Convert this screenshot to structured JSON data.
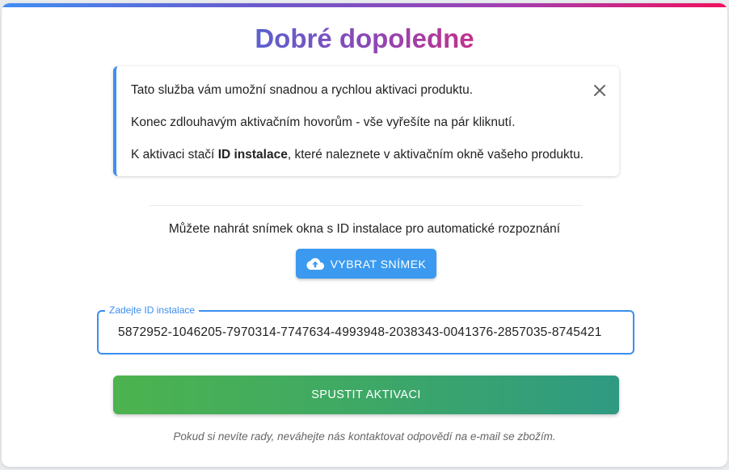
{
  "header": {
    "title": "Dobré dopoledne"
  },
  "info": {
    "line1": "Tato služba vám umožní snadnou a rychlou aktivaci produktu.",
    "line2": "Konec zdlouhavým aktivačním hovorům - vše vyřešíte na pár kliknutí.",
    "line3_before": "K aktivaci stačí ",
    "line3_bold": "ID instalace",
    "line3_after": ", které naleznete v aktivačním okně vašeho produktu.",
    "close_icon": "close-icon"
  },
  "upload": {
    "hint": "Můžete nahrát snímek okna s ID instalace pro automatické rozpoznání",
    "button_label": "VYBRAT SNÍMEK",
    "button_icon": "cloud-upload-icon"
  },
  "installation_id": {
    "label": "Zadejte ID instalace",
    "value": "5872952-1046205-7970314-7747634-4993948-2038343-0041376-2857035-8745421"
  },
  "activation": {
    "button_label": "SPUSTIT AKTIVACI"
  },
  "footer": {
    "note": "Pokud si nevíte rady, neváhejte nás kontaktovat odpovědí na e-mail se zbožím."
  },
  "colors": {
    "accent_blue": "#3b9af0",
    "green_start": "#4cb34e",
    "green_end": "#2f9a82",
    "title_start": "#5b62cf",
    "title_end": "#c2328c"
  }
}
